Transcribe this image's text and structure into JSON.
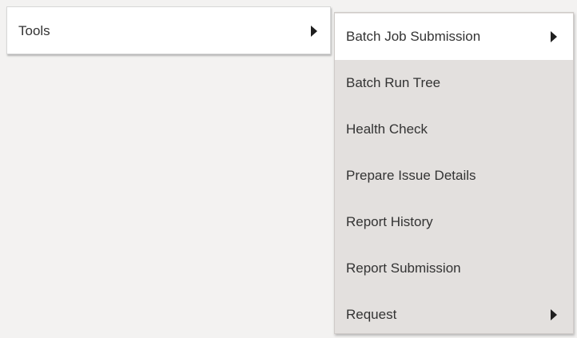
{
  "menu": {
    "parent_item": {
      "label": "Tools",
      "icon": "chevron-right-triangle-icon"
    },
    "submenu_items": [
      {
        "label": "Batch Job Submission",
        "has_submenu": true,
        "highlighted": true
      },
      {
        "label": "Batch Run Tree",
        "has_submenu": false
      },
      {
        "label": "Health Check",
        "has_submenu": false
      },
      {
        "label": "Prepare Issue Details",
        "has_submenu": false
      },
      {
        "label": "Report History",
        "has_submenu": false
      },
      {
        "label": "Report Submission",
        "has_submenu": false
      },
      {
        "label": "Request",
        "has_submenu": true
      }
    ]
  },
  "colors": {
    "background": "#f3f2f1",
    "submenu_background": "#e3e0de",
    "highlight_background": "#ffffff",
    "text": "#333333",
    "arrow": "#1f1f1f"
  }
}
